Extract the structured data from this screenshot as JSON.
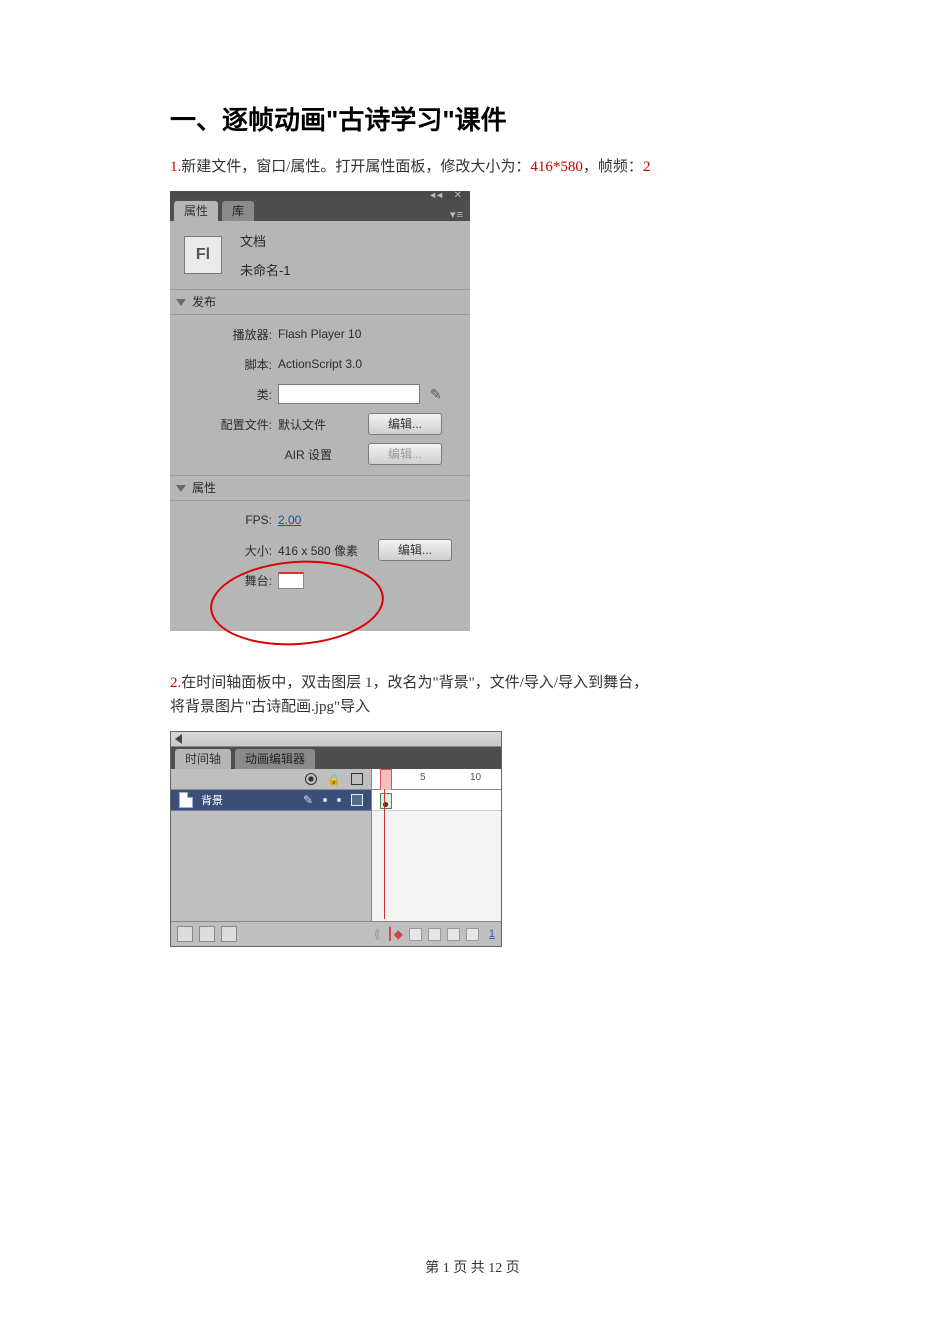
{
  "heading": "一、逐帧动画\"古诗学习\"课件",
  "step1": {
    "num": "1.",
    "text_a": "新建文件，窗口/属性。打开属性面板，修改大小为：",
    "size": "416*580",
    "text_b": "，帧频：",
    "fps": "2"
  },
  "panel1": {
    "tabs": [
      "属性",
      "库"
    ],
    "doc_label": "文档",
    "doc_name": "未命名-1",
    "section_publish": "发布",
    "player_label": "播放器:",
    "player_value": "Flash Player 10",
    "script_label": "脚本:",
    "script_value": "ActionScript 3.0",
    "class_label": "类:",
    "profile_label": "配置文件:",
    "profile_value": "默认文件",
    "edit_button": "编辑...",
    "air_label": "AIR 设置",
    "section_props": "属性",
    "fps_label": "FPS:",
    "fps_value": "2.00",
    "size_label": "大小:",
    "size_value": "416 x 580 像素",
    "stage_label": "舞台:"
  },
  "step2": {
    "num": "2.",
    "line1": "在时间轴面板中，双击图层 1，改名为\"背景\"，文件/导入/导入到舞台，",
    "line2": "将背景图片\"古诗配画.jpg\"导入"
  },
  "panel2": {
    "tabs": [
      "时间轴",
      "动画编辑器"
    ],
    "layer_name": "背景",
    "ruler_marks": [
      "5",
      "10"
    ],
    "footer_frame": "1"
  },
  "page_footer": {
    "prefix": "第 ",
    "current": "1",
    "middle": " 页 共 ",
    "total": "12",
    "suffix": " 页"
  }
}
